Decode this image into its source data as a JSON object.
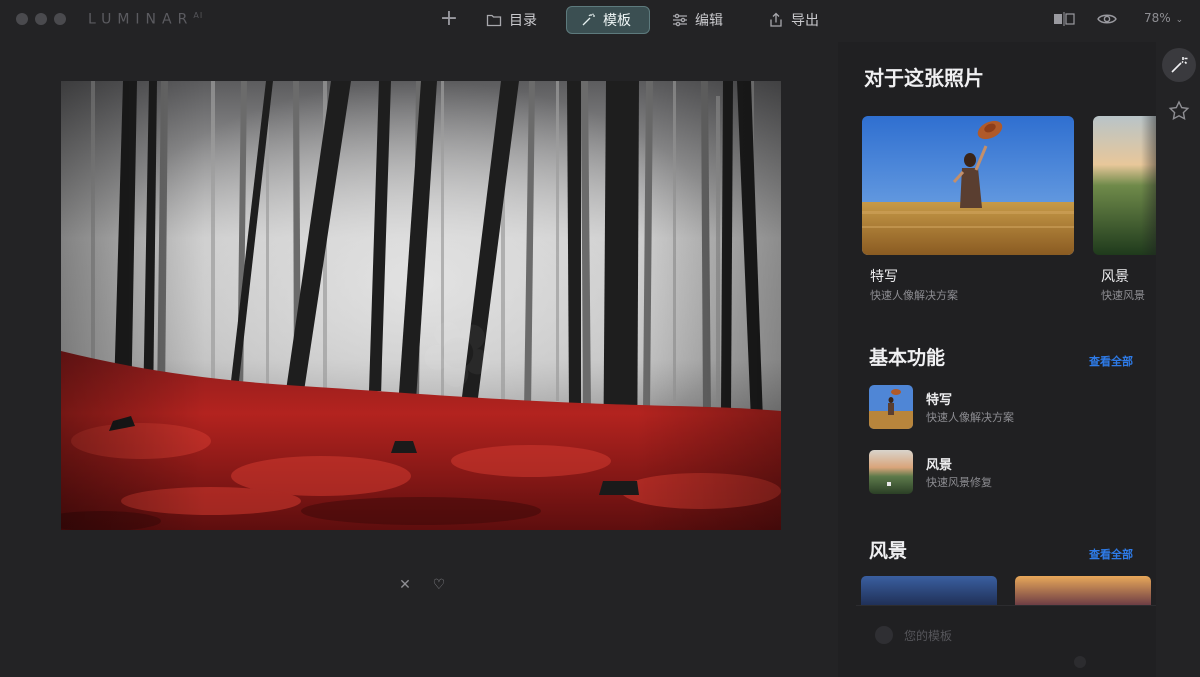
{
  "app": {
    "brand": "LUMINAR",
    "brand_suffix": "AI"
  },
  "toolbar": {
    "add_label": "+",
    "catalog_label": "目录",
    "templates_label": "模板",
    "edit_label": "编辑",
    "export_label": "导出",
    "zoom_level": "78%",
    "zoom_chevron": "⌄"
  },
  "photo_actions": {
    "reject_glyph": "✕",
    "favorite_glyph": "♡"
  },
  "panel": {
    "title": "对于这张照片",
    "hero_cards": [
      {
        "title": "特写",
        "subtitle": "快速人像解决方案"
      },
      {
        "title": "风景",
        "subtitle": "快速风景"
      }
    ],
    "basic": {
      "title": "基本功能",
      "see_all": "查看全部",
      "items": [
        {
          "title": "特写",
          "subtitle": "快速人像解决方案"
        },
        {
          "title": "风景",
          "subtitle": "快速风景修复"
        }
      ]
    },
    "landscape": {
      "title": "风景",
      "see_all": "查看全部"
    },
    "your_templates": "您的模板"
  },
  "colors": {
    "accent_blue": "#2e7be8",
    "templates_active_bg": "#3b4f52",
    "background": "#232325"
  },
  "icons": {
    "catalog": "folder-icon",
    "templates": "magic-wand-icon",
    "edit": "sliders-icon",
    "export": "share-icon",
    "compare": "compare-icon",
    "preview": "eye-icon",
    "rail_ai": "magic-wand-icon",
    "rail_favorites": "star-icon"
  }
}
